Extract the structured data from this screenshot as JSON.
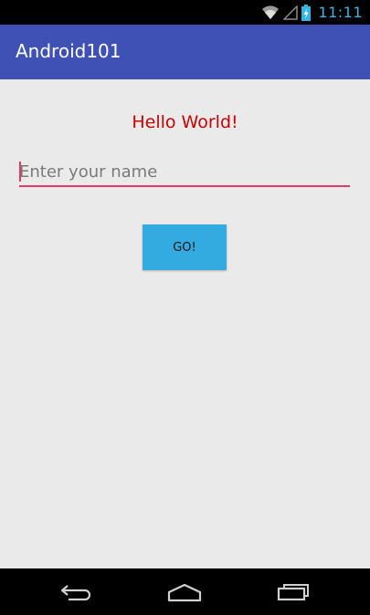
{
  "status_bar": {
    "time": "11:11",
    "icons": [
      "wifi-icon",
      "signal-icon",
      "battery-charging-icon"
    ],
    "accent_color": "#33b5e5"
  },
  "app_bar": {
    "title": "Android101",
    "color": "#3f51b5"
  },
  "main": {
    "greeting": "Hello World!",
    "greeting_color": "#cc0000",
    "name_input": {
      "placeholder": "Enter your name",
      "value": ""
    },
    "go_button_label": "GO!",
    "go_button_color": "#33abe0",
    "input_underline_color": "#e03a6a"
  },
  "nav_bar": {
    "icons": [
      "back-icon",
      "home-icon",
      "recent-apps-icon"
    ]
  }
}
